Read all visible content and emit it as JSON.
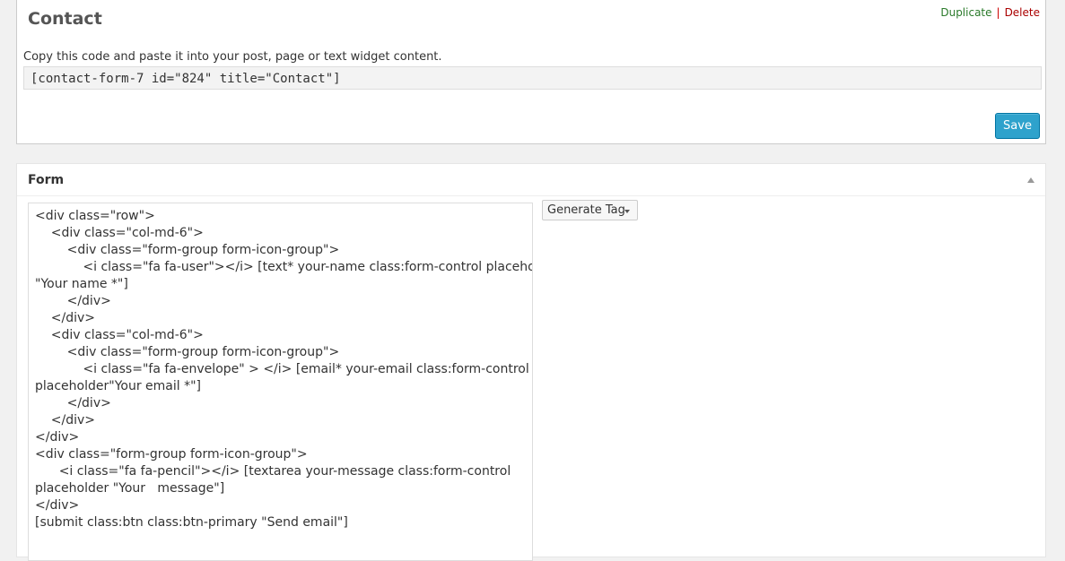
{
  "header": {
    "title": "Contact",
    "duplicate_label": "Duplicate",
    "separator": "|",
    "delete_label": "Delete"
  },
  "shortcode": {
    "hint": "Copy this code and paste it into your post, page or text widget content.",
    "value": "[contact-form-7 id=\"824\" title=\"Contact\"]"
  },
  "save_label": "Save",
  "form_panel": {
    "title": "Form",
    "generate_tag_label": "Generate Tag",
    "code_lines": [
      "<div class=\"row\">",
      "    <div class=\"col-md-6\">",
      "        <div class=\"form-group form-icon-group\">",
      "            <i class=\"fa fa-user\"></i> [text* your-name class:form-control placeholder",
      "\"Your name *\"]",
      "        </div>",
      "    </div>",
      "    <div class=\"col-md-6\">",
      "        <div class=\"form-group form-icon-group\">",
      "            <i class=\"fa fa-envelope\" > </i> [email* your-email class:form-control",
      "placeholder\"Your email *\"]",
      "        </div>",
      "    </div>",
      "</div>",
      "<div class=\"form-group form-icon-group\">",
      "      <i class=\"fa fa-pencil\"></i> [textarea your-message class:form-control",
      "placeholder \"Your   message\"]",
      "</div>",
      "[submit class:btn class:btn-primary \"Send email\"]"
    ]
  }
}
